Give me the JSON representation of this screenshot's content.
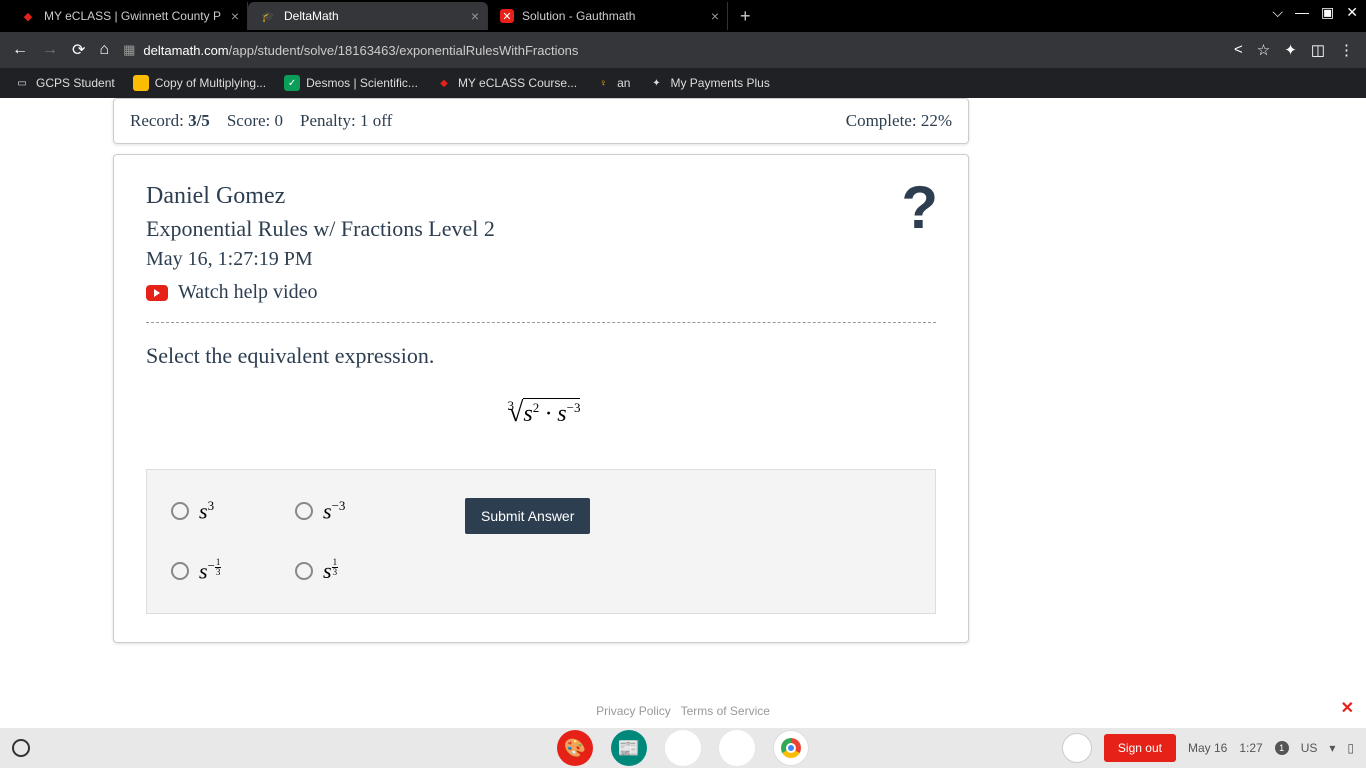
{
  "tabs": [
    {
      "title": "MY eCLASS | Gwinnett County P"
    },
    {
      "title": "DeltaMath"
    },
    {
      "title": "Solution - Gauthmath"
    }
  ],
  "url": {
    "domain": "deltamath.com",
    "path": "/app/student/solve/18163463/exponentialRulesWithFractions"
  },
  "bookmarks": [
    {
      "label": "GCPS Student"
    },
    {
      "label": "Copy of Multiplying..."
    },
    {
      "label": "Desmos | Scientific..."
    },
    {
      "label": "MY eCLASS Course..."
    },
    {
      "label": "an"
    },
    {
      "label": "My Payments Plus"
    }
  ],
  "record": {
    "label": "Record:",
    "value": "3/5"
  },
  "score": {
    "label": "Score:",
    "value": "0"
  },
  "penalty": {
    "label": "Penalty:",
    "value": "1 off"
  },
  "complete": {
    "label": "Complete:",
    "value": "22%"
  },
  "student": "Daniel Gomez",
  "assignment": "Exponential Rules w/ Fractions Level 2",
  "datetime": "May 16, 1:27:19 PM",
  "watch": "Watch help video",
  "prompt": "Select the equivalent expression.",
  "expression": {
    "root_index": "3",
    "radicand_base_a": "s",
    "exp_a": "2",
    "dot": "·",
    "radicand_base_b": "s",
    "exp_b": "−3"
  },
  "options": {
    "a": {
      "base": "s",
      "exp": "3"
    },
    "b": {
      "base": "s",
      "exp": "−3"
    },
    "c": {
      "base": "s",
      "neg": "−",
      "num": "1",
      "den": "3"
    },
    "d": {
      "base": "s",
      "num": "1",
      "den": "3"
    }
  },
  "submit": "Submit Answer",
  "footer": {
    "privacy": "Privacy Policy",
    "tos": "Terms of Service"
  },
  "taskbar": {
    "signout": "Sign out",
    "date": "May 16",
    "time": "1:27",
    "notif": "1",
    "lang": "US"
  }
}
